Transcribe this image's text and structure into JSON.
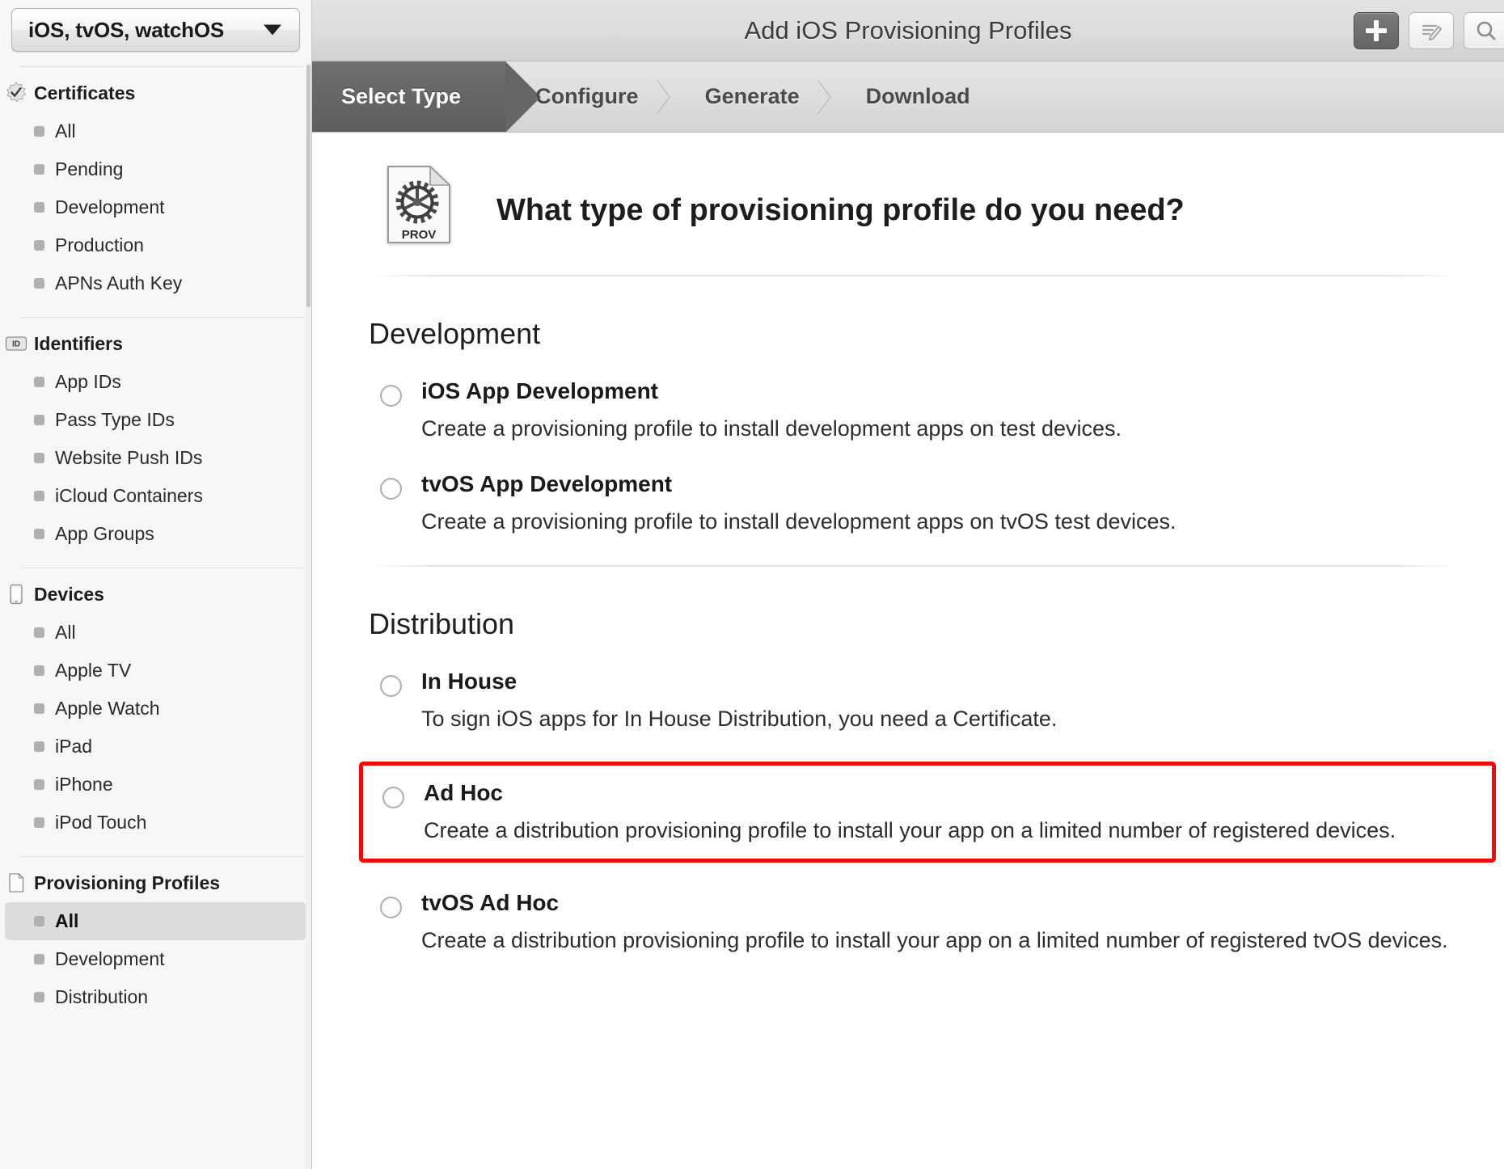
{
  "sidebar": {
    "platform_select": {
      "value": "iOS, tvOS, watchOS",
      "caret_icon": "chevron-down-icon"
    },
    "groups": [
      {
        "title": "Certificates",
        "icon": "certificate-seal-icon",
        "items": [
          {
            "label": "All",
            "selected": false
          },
          {
            "label": "Pending",
            "selected": false
          },
          {
            "label": "Development",
            "selected": false
          },
          {
            "label": "Production",
            "selected": false
          },
          {
            "label": "APNs Auth Key",
            "selected": false
          }
        ]
      },
      {
        "title": "Identifiers",
        "icon": "id-badge-icon",
        "items": [
          {
            "label": "App IDs",
            "selected": false
          },
          {
            "label": "Pass Type IDs",
            "selected": false
          },
          {
            "label": "Website Push IDs",
            "selected": false
          },
          {
            "label": "iCloud Containers",
            "selected": false
          },
          {
            "label": "App Groups",
            "selected": false
          }
        ]
      },
      {
        "title": "Devices",
        "icon": "device-icon",
        "items": [
          {
            "label": "All",
            "selected": false
          },
          {
            "label": "Apple TV",
            "selected": false
          },
          {
            "label": "Apple Watch",
            "selected": false
          },
          {
            "label": "iPad",
            "selected": false
          },
          {
            "label": "iPhone",
            "selected": false
          },
          {
            "label": "iPod Touch",
            "selected": false
          }
        ]
      },
      {
        "title": "Provisioning Profiles",
        "icon": "document-icon",
        "items": [
          {
            "label": "All",
            "selected": true
          },
          {
            "label": "Development",
            "selected": false
          },
          {
            "label": "Distribution",
            "selected": false
          }
        ]
      }
    ]
  },
  "titlebar": {
    "title": "Add iOS Provisioning Profiles",
    "buttons": [
      {
        "name": "add-button",
        "icon": "plus-icon",
        "primary": true
      },
      {
        "name": "edit-button",
        "icon": "edit-pencil-icon",
        "primary": false
      },
      {
        "name": "search-button",
        "icon": "search-icon",
        "primary": false
      }
    ]
  },
  "steps": [
    {
      "label": "Select Type",
      "active": true
    },
    {
      "label": "Configure",
      "active": false
    },
    {
      "label": "Generate",
      "active": false
    },
    {
      "label": "Download",
      "active": false
    }
  ],
  "hero": {
    "icon": "provisioning-profile-document-icon",
    "icon_label": "PROV",
    "heading": "What type of provisioning profile do you need?"
  },
  "sections": [
    {
      "title": "Development",
      "options": [
        {
          "title": "iOS App Development",
          "desc": "Create a provisioning profile to install development apps on test devices.",
          "highlighted": false
        },
        {
          "title": "tvOS App Development",
          "desc": "Create a provisioning profile to install development apps on tvOS test devices.",
          "highlighted": false
        }
      ]
    },
    {
      "title": "Distribution",
      "options": [
        {
          "title": "In House",
          "desc": "To sign iOS apps for In House Distribution, you need a Certificate.",
          "highlighted": false
        },
        {
          "title": "Ad Hoc",
          "desc": "Create a distribution provisioning profile to install your app on a limited number of registered devices.",
          "highlighted": true
        },
        {
          "title": "tvOS Ad Hoc",
          "desc": "Create a distribution provisioning profile to install your app on a limited number of registered tvOS devices.",
          "highlighted": false
        }
      ]
    }
  ],
  "colors": {
    "highlight_border": "#ed0b0b",
    "active_step_bg": "#666666",
    "sidebar_bg": "#f7f7f7",
    "selected_item_bg": "#dcdcdc"
  }
}
